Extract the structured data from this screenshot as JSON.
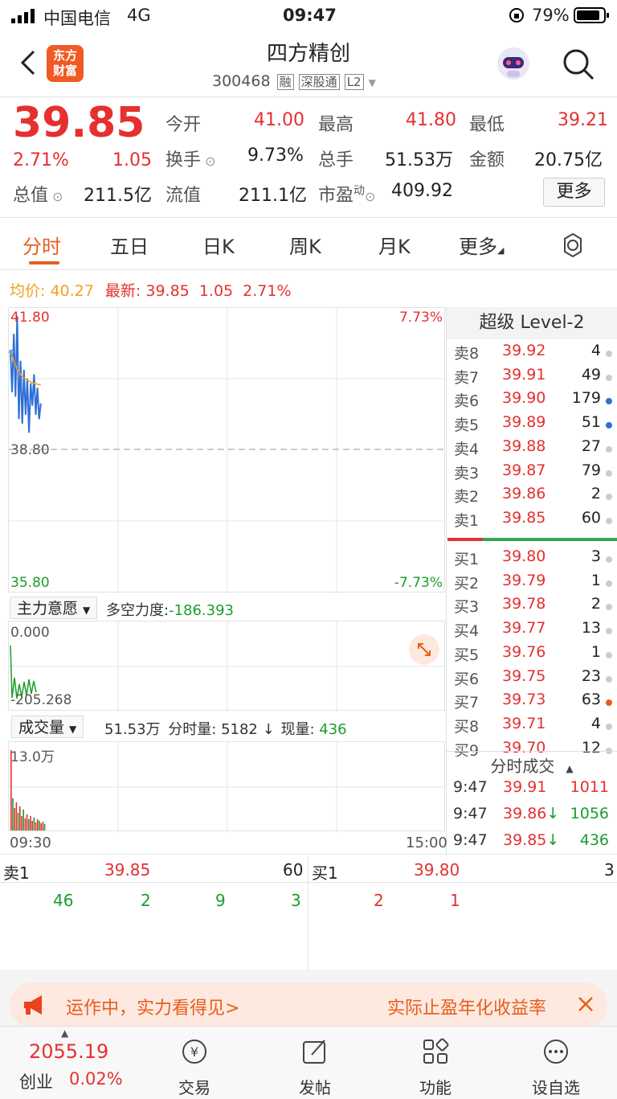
{
  "status_bar": {
    "carrier": "中国电信",
    "network": "4G",
    "time": "09:47",
    "battery": "79%"
  },
  "header": {
    "back_icon": "chevron-left-icon",
    "logo_line1": "东方",
    "logo_line2": "财富",
    "title": "四方精创",
    "code": "300468",
    "tags": [
      "融",
      "深股通",
      "L2"
    ],
    "search_icon": "search-icon",
    "robot_icon": "robot-assistant-icon"
  },
  "quote": {
    "price": "39.85",
    "change_pct": "2.71%",
    "change_amt": "1.05",
    "total_value_label": "总值",
    "total_value": "211.5亿",
    "fields": [
      {
        "label": "今开",
        "value": "41.00"
      },
      {
        "label": "最高",
        "value": "41.80"
      },
      {
        "label": "最低",
        "value": "39.21"
      },
      {
        "label": "换手",
        "value": "9.73%"
      },
      {
        "label": "总手",
        "value": "51.53万"
      },
      {
        "label": "金额",
        "value": "20.75亿"
      },
      {
        "label": "流值",
        "value": "211.1亿"
      },
      {
        "label": "市盈",
        "sup": "动",
        "value": "409.92"
      }
    ],
    "more_button": "更多"
  },
  "tabs": [
    "分时",
    "五日",
    "日K",
    "周K",
    "月K",
    "更多",
    ""
  ],
  "summary": {
    "avg_label": "均价:",
    "avg": "40.27",
    "latest_label": "最新:",
    "latest": "39.85",
    "chg": "1.05",
    "pct": "2.71%"
  },
  "chart_data": {
    "type": "line",
    "title": "",
    "y_max_label": "41.80",
    "y_mid_label": "38.80",
    "y_min_label": "35.80",
    "pct_max_label": "7.73%",
    "pct_min_label": "-7.73%",
    "x_start": "09:30",
    "x_end": "15:00",
    "ylim": [
      35.8,
      41.8
    ],
    "series": [
      {
        "values": [
          41.0,
          40.1,
          41.4,
          40.0,
          41.8,
          39.5,
          40.8,
          39.4,
          40.6,
          39.6,
          40.4,
          39.2,
          40.3,
          39.8,
          40.5,
          39.6,
          40.2,
          39.5,
          39.85
        ]
      },
      {
        "values": [
          41.0,
          40.9,
          40.8,
          40.7,
          40.6,
          40.55,
          40.5,
          40.45,
          40.42,
          40.4,
          40.38,
          40.35,
          40.33,
          40.31,
          40.3,
          40.29,
          40.28,
          40.27,
          40.27
        ]
      }
    ]
  },
  "orderbook": {
    "title": "超级 Level-2",
    "asks": [
      {
        "label": "卖8",
        "price": "39.92",
        "vol": "4",
        "dot": "#cccccc"
      },
      {
        "label": "卖7",
        "price": "39.91",
        "vol": "49",
        "dot": "#cccccc"
      },
      {
        "label": "卖6",
        "price": "39.90",
        "vol": "179",
        "dot": "#2f6fd6"
      },
      {
        "label": "卖5",
        "price": "39.89",
        "vol": "51",
        "dot": "#2f6fd6"
      },
      {
        "label": "卖4",
        "price": "39.88",
        "vol": "27",
        "dot": "#cccccc"
      },
      {
        "label": "卖3",
        "price": "39.87",
        "vol": "79",
        "dot": "#cccccc"
      },
      {
        "label": "卖2",
        "price": "39.86",
        "vol": "2",
        "dot": "#cccccc"
      },
      {
        "label": "卖1",
        "price": "39.85",
        "vol": "60",
        "dot": "#cccccc"
      }
    ],
    "bids": [
      {
        "label": "买1",
        "price": "39.80",
        "vol": "3",
        "dot": "#cccccc"
      },
      {
        "label": "买2",
        "price": "39.79",
        "vol": "1",
        "dot": "#cccccc"
      },
      {
        "label": "买3",
        "price": "39.78",
        "vol": "2",
        "dot": "#cccccc"
      },
      {
        "label": "买4",
        "price": "39.77",
        "vol": "13",
        "dot": "#cccccc"
      },
      {
        "label": "买5",
        "price": "39.76",
        "vol": "1",
        "dot": "#cccccc"
      },
      {
        "label": "买6",
        "price": "39.75",
        "vol": "23",
        "dot": "#cccccc"
      },
      {
        "label": "买7",
        "price": "39.73",
        "vol": "63",
        "dot": "#e85d1c"
      },
      {
        "label": "买8",
        "price": "39.71",
        "vol": "4",
        "dot": "#cccccc"
      },
      {
        "label": "买9",
        "price": "39.70",
        "vol": "12",
        "dot": "#cccccc"
      }
    ]
  },
  "ticks": {
    "title": "分时成交",
    "rows": [
      {
        "time": "9:47",
        "price": "39.91",
        "arrow": "",
        "vol": "1011",
        "vol_color": "red"
      },
      {
        "time": "9:47",
        "price": "39.86",
        "arrow": "↓",
        "vol": "1056",
        "vol_color": "green"
      },
      {
        "time": "9:47",
        "price": "39.85",
        "arrow": "↓",
        "vol": "436",
        "vol_color": "green"
      }
    ]
  },
  "force_panel": {
    "label": "主力意愿",
    "metric_label": "多空力度:",
    "metric_value": "-186.393",
    "top_label": "0.000",
    "bottom_label": "-205.268"
  },
  "volume_panel": {
    "label": "成交量",
    "total": "51.53万",
    "minute_label": "分时量:",
    "minute_value": "5182",
    "arrow": "↓",
    "now_label": "现量:",
    "now_value": "436",
    "y_label": "13.0万"
  },
  "level_bar": {
    "sell_label": "卖1",
    "sell_price": "39.85",
    "sell_vol": "60",
    "buy_label": "买1",
    "buy_price": "39.80",
    "buy_vol": "3",
    "sell_queue": [
      "46",
      "2",
      "9",
      "3"
    ],
    "buy_queue": [
      "2",
      "1"
    ]
  },
  "banner": {
    "icon": "megaphone-icon",
    "left_text": "运作中，实力看得见>",
    "right_text": "实际止盈年化收益率",
    "close_icon": "close-icon"
  },
  "bottom_nav": {
    "index_value": "2055.19",
    "index_name": "创业",
    "index_pct": "0.02%",
    "items": [
      {
        "label": "交易",
        "icon": "trade-icon"
      },
      {
        "label": "发帖",
        "icon": "post-icon"
      },
      {
        "label": "功能",
        "icon": "grid-icon"
      },
      {
        "label": "设自选",
        "icon": "more-icon"
      }
    ]
  }
}
